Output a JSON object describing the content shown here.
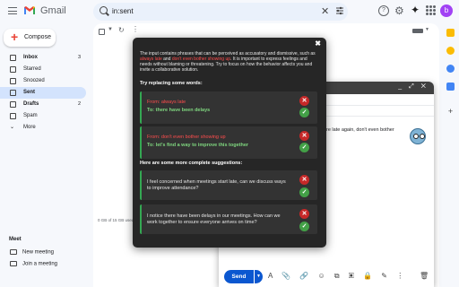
{
  "app": {
    "name": "Gmail"
  },
  "search": {
    "value": "in:sent"
  },
  "account": {
    "initial": "b"
  },
  "compose_button": {
    "label": "Compose"
  },
  "nav": [
    {
      "label": "Inbox",
      "count": "3",
      "bold": true
    },
    {
      "label": "Starred",
      "count": ""
    },
    {
      "label": "Snoozed",
      "count": ""
    },
    {
      "label": "Sent",
      "count": "",
      "active": true
    },
    {
      "label": "Drafts",
      "count": "2",
      "bold": true
    },
    {
      "label": "Spam",
      "count": ""
    },
    {
      "label": "More",
      "count": ""
    }
  ],
  "meet": {
    "heading": "Meet",
    "new_meeting": "New meeting",
    "join_meeting": "Join a meeting"
  },
  "storage": "0 GB of 15 GB used",
  "compose_window": {
    "body_text": "re late again, don't even bother",
    "send_label": "Send"
  },
  "feedback": {
    "intro_1": "The input contains phrases that can be perceived as accusatory and dismissive, such as ",
    "intro_hl_1": "always late",
    "intro_2": " and ",
    "intro_hl_2": "don't even bother showing up",
    "intro_3": ". It is important to express feelings and needs without blaming or threatening. Try to focus on how the behavior affects you and invite a collaborative solution.",
    "replace_heading": "Try replacing some words:",
    "replacements": [
      {
        "from": "From: always late",
        "to": "To: there have been delays"
      },
      {
        "from": "From: don't even bother showing up",
        "to": "To: let's find a way to improve this together"
      }
    ],
    "suggestions_heading": "Here are some more complete suggestions:",
    "suggestions": [
      "I feel concerned when meetings start late, can we discuss ways to improve attendance?",
      "I notice there have been delays in our meetings. How can we work together to ensure everyone arrives on time?"
    ]
  },
  "colors": {
    "accent": "#0b57d0",
    "highlight_red": "#ff4d4d",
    "suggest_green": "#7fd67f",
    "overlay_bg": "#262626"
  }
}
